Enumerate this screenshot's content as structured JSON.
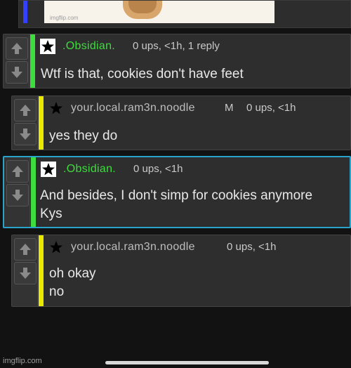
{
  "image_card": {
    "watermark": "imgflip.com"
  },
  "comments": [
    {
      "username": ".Obsidian.",
      "meta": "0 ups, <1h, 1 reply",
      "body": "Wtf is that, cookies don't have feet"
    },
    {
      "username": "your.local.ram3n.noodle",
      "mod_tag": "M",
      "meta": "0 ups, <1h",
      "body": "yes they do"
    },
    {
      "username": ".Obsidian.",
      "meta": "0 ups, <1h",
      "body_line1": "And besides, I don't simp for cookies anymore",
      "body_line2": "Kys"
    },
    {
      "username": "your.local.ram3n.noodle",
      "meta": "0 ups, <1h",
      "body_line1": "oh okay",
      "body_line2": "no"
    }
  ],
  "footer": {
    "watermark": "imgflip.com"
  },
  "colors": {
    "green_bar": "#3ddd3d",
    "yellow_bar": "#e8e800",
    "highlight_border": "#29a3cc",
    "image_bar": "#3340ff"
  },
  "icons": {
    "upvote": "arrow-up-icon",
    "downvote": "arrow-down-icon",
    "white_star": "star-icon",
    "black_star": "star-icon"
  }
}
